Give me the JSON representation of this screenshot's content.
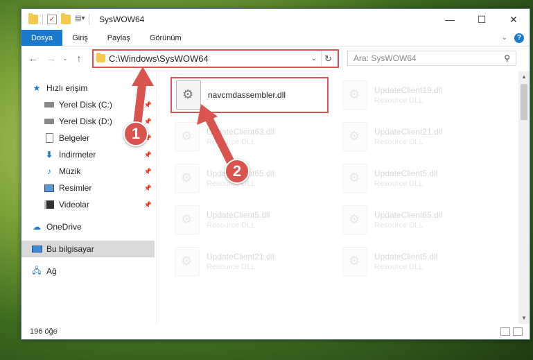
{
  "window": {
    "title": "SysWOW64",
    "controls": [
      "—",
      "☐",
      "✕"
    ]
  },
  "ribbon": {
    "tabs": [
      {
        "label": "Dosya",
        "active": true
      },
      {
        "label": "Giriş",
        "active": false
      },
      {
        "label": "Paylaş",
        "active": false
      },
      {
        "label": "Görünüm",
        "active": false
      }
    ]
  },
  "address": {
    "path": "C:\\Windows\\SysWOW64",
    "search_placeholder": "Ara: SysWOW64"
  },
  "sidebar": {
    "items": [
      {
        "label": "Hızlı erişim",
        "icon": "star-icon"
      },
      {
        "label": "Yerel Disk (C:)",
        "icon": "disk-icon",
        "pinned": true
      },
      {
        "label": "Yerel Disk (D:)",
        "icon": "disk-icon",
        "pinned": true
      },
      {
        "label": "Belgeler",
        "icon": "document-icon",
        "pinned": true
      },
      {
        "label": "İndirmeler",
        "icon": "download-icon",
        "pinned": true
      },
      {
        "label": "Müzik",
        "icon": "music-icon",
        "pinned": true
      },
      {
        "label": "Resimler",
        "icon": "pictures-icon",
        "pinned": true
      },
      {
        "label": "Videolar",
        "icon": "video-icon",
        "pinned": true
      },
      {
        "label": "OneDrive",
        "icon": "cloud-icon"
      },
      {
        "label": "Bu bilgisayar",
        "icon": "computer-icon",
        "selected": true
      },
      {
        "label": "Ağ",
        "icon": "network-icon"
      }
    ]
  },
  "files": [
    {
      "name": "navcmdassembler.dll",
      "type": "",
      "highlight": true
    },
    {
      "name": "UpdateClient19.dll",
      "type": "Resource DLL"
    },
    {
      "name": "UpdateClient63.dll",
      "type": "Resource DLL"
    },
    {
      "name": "UpdateClient21.dll",
      "type": "Resource DLL"
    },
    {
      "name": "UpdateClient65.dll",
      "type": "Resource DLL"
    },
    {
      "name": "UpdateClient5.dll",
      "type": "Resource DLL"
    },
    {
      "name": "UpdateClient5.dll",
      "type": "Resource DLL"
    },
    {
      "name": "UpdateClient65.dll",
      "type": "Resource DLL"
    },
    {
      "name": "UpdateClient21.dll",
      "type": "Resource DLL"
    },
    {
      "name": "UpdateClient5.dll",
      "type": "Resource DLL"
    }
  ],
  "status": {
    "count": "196 öğe"
  },
  "annotations": {
    "step1": "1",
    "step2": "2"
  },
  "colors": {
    "accent": "#1979ca",
    "annotation": "#d9534f"
  }
}
